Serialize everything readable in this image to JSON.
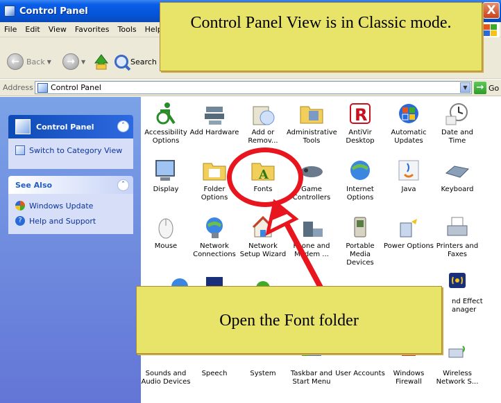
{
  "window": {
    "title": "Control Panel",
    "close_label": "X"
  },
  "menu": [
    "File",
    "Edit",
    "View",
    "Favorites",
    "Tools",
    "Help"
  ],
  "toolbar": {
    "back_label": "Back",
    "search_label": "Search"
  },
  "address": {
    "label": "Address",
    "value": "Control Panel",
    "go_label": "Go"
  },
  "sidebar": {
    "control_panel": {
      "title": "Control Panel",
      "link": "Switch to Category View"
    },
    "see_also": {
      "title": "See Also",
      "items": [
        "Windows Update",
        "Help and Support"
      ]
    }
  },
  "icons": [
    {
      "label": "Accessibility Options",
      "icon": "accessibility-icon"
    },
    {
      "label": "Add Hardware",
      "icon": "add-hardware-icon"
    },
    {
      "label": "Add or Remov...",
      "icon": "add-remove-programs-icon"
    },
    {
      "label": "Administrative Tools",
      "icon": "administrative-tools-icon"
    },
    {
      "label": "AntiVir Desktop",
      "icon": "antivir-icon"
    },
    {
      "label": "Automatic Updates",
      "icon": "automatic-updates-icon"
    },
    {
      "label": "Date and Time",
      "icon": "date-time-icon"
    },
    {
      "label": "Display",
      "icon": "display-icon"
    },
    {
      "label": "Folder Options",
      "icon": "folder-options-icon"
    },
    {
      "label": "Fonts",
      "icon": "fonts-icon"
    },
    {
      "label": "Game Controllers",
      "icon": "game-controllers-icon"
    },
    {
      "label": "Internet Options",
      "icon": "internet-options-icon"
    },
    {
      "label": "Java",
      "icon": "java-icon"
    },
    {
      "label": "Keyboard",
      "icon": "keyboard-icon"
    },
    {
      "label": "Mouse",
      "icon": "mouse-icon"
    },
    {
      "label": "Network Connections",
      "icon": "network-connections-icon"
    },
    {
      "label": "Network Setup Wizard",
      "icon": "network-setup-wizard-icon"
    },
    {
      "label": "Phone and Modem ...",
      "icon": "phone-modem-icon"
    },
    {
      "label": "Portable Media Devices",
      "icon": "portable-media-devices-icon"
    },
    {
      "label": "Power Options",
      "icon": "power-options-icon"
    },
    {
      "label": "Printers and Faxes",
      "icon": "printers-faxes-icon"
    },
    {
      "label": "nd Effect anager",
      "icon": "sound-effect-manager-icon"
    },
    {
      "label": "Sounds and Audio Devices",
      "icon": "sounds-audio-icon"
    },
    {
      "label": "Speech",
      "icon": "speech-icon"
    },
    {
      "label": "System",
      "icon": "system-icon"
    },
    {
      "label": "Taskbar and Start Menu",
      "icon": "taskbar-start-menu-icon"
    },
    {
      "label": "User Accounts",
      "icon": "user-accounts-icon"
    },
    {
      "label": "Windows Firewall",
      "icon": "windows-firewall-icon"
    },
    {
      "label": "Wireless Network S...",
      "icon": "wireless-network-icon"
    }
  ],
  "annotations": {
    "top": "Control Panel View is in Classic mode.",
    "bottom": "Open the Font folder"
  }
}
